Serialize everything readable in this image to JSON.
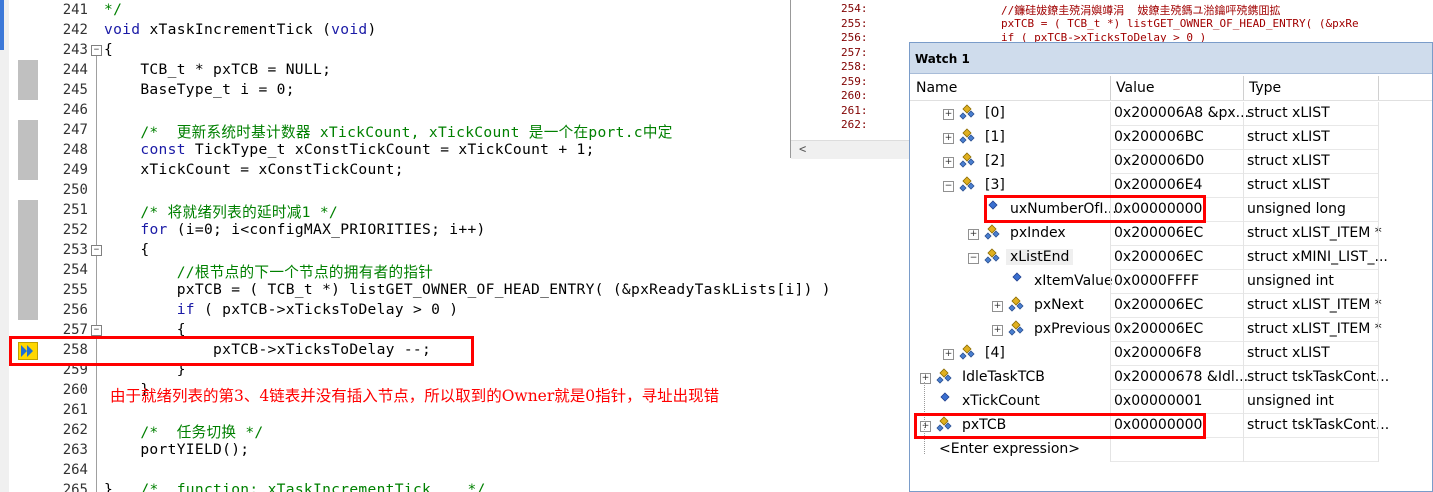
{
  "editor": {
    "lines": [
      {
        "num": "241",
        "text": "*/",
        "fold": "",
        "kind": "comment"
      },
      {
        "num": "242",
        "text": "void xTaskIncrementTick (void)",
        "fold": "",
        "kind": "sig"
      },
      {
        "num": "243",
        "text": "{",
        "fold": "−",
        "kind": "plain"
      },
      {
        "num": "244",
        "text": "    TCB_t * pxTCB = NULL;",
        "fold": "",
        "kind": "plain"
      },
      {
        "num": "245",
        "text": "    BaseType_t i = 0;",
        "fold": "",
        "kind": "plain"
      },
      {
        "num": "246",
        "text": "",
        "fold": "",
        "kind": "plain"
      },
      {
        "num": "247",
        "text": "    /*  更新系统时基计数器 xTickCount, xTickCount 是一个在port.c中定",
        "fold": "",
        "kind": "comment"
      },
      {
        "num": "248",
        "text": "    const TickType_t xConstTickCount = xTickCount + 1;",
        "fold": "",
        "kind": "const"
      },
      {
        "num": "249",
        "text": "    xTickCount = xConstTickCount;",
        "fold": "",
        "kind": "plain"
      },
      {
        "num": "250",
        "text": "",
        "fold": "",
        "kind": "plain"
      },
      {
        "num": "251",
        "text": "    /* 将就绪列表的延时减1 */",
        "fold": "",
        "kind": "comment"
      },
      {
        "num": "252",
        "text": "    for (i=0; i<configMAX_PRIORITIES; i++)",
        "fold": "",
        "kind": "for"
      },
      {
        "num": "253",
        "text": "    {",
        "fold": "−",
        "kind": "plain"
      },
      {
        "num": "254",
        "text": "        //根节点的下一个节点的拥有者的指针",
        "fold": "",
        "kind": "comment"
      },
      {
        "num": "255",
        "text": "        pxTCB = ( TCB_t *) listGET_OWNER_OF_HEAD_ENTRY( (&pxReadyTaskLists[i]) )",
        "fold": "",
        "kind": "plain"
      },
      {
        "num": "256",
        "text": "        if ( pxTCB->xTicksToDelay > 0 )",
        "fold": "",
        "kind": "if"
      },
      {
        "num": "257",
        "text": "        {",
        "fold": "−",
        "kind": "plain"
      },
      {
        "num": "258",
        "text": "            pxTCB->xTicksToDelay --;",
        "fold": "",
        "kind": "plain"
      },
      {
        "num": "259",
        "text": "        }",
        "fold": "",
        "kind": "plain"
      },
      {
        "num": "260",
        "text": "    }",
        "fold": "",
        "kind": "plain"
      },
      {
        "num": "261",
        "text": "",
        "fold": "",
        "kind": "plain"
      },
      {
        "num": "262",
        "text": "    /*  任务切换 */",
        "fold": "",
        "kind": "comment"
      },
      {
        "num": "263",
        "text": "    portYIELD();",
        "fold": "",
        "kind": "plain"
      },
      {
        "num": "264",
        "text": "",
        "fold": "",
        "kind": "plain"
      },
      {
        "num": "265",
        "text": "}   /*  function: xTaskIncrementTick    */",
        "fold": "",
        "kind": "endcomment"
      }
    ],
    "annotation": "由于就绪列表的第3、4链表并没有插入节点，所以取到的Owner就是0指针，寻址出现错"
  },
  "disasm": {
    "lines": [
      {
        "addr": "254:",
        "src": "//鐮硅妭鐐圭殑涓嬩竴涓  妭鐐圭殑鎷ユ湁鑰呯殑鎸囬拡"
      },
      {
        "addr": "255:",
        "src": "pxTCB = ( TCB_t *) listGET_OWNER_OF_HEAD_ENTRY( (&pxRe"
      },
      {
        "addr": "256:",
        "src": "if ( pxTCB->xTicksToDelay > 0 )"
      },
      {
        "addr": "257:",
        "src": ""
      },
      {
        "addr": "258:",
        "src": ""
      },
      {
        "addr": "259:",
        "src": ""
      },
      {
        "addr": "260:",
        "src": ""
      },
      {
        "addr": "261:",
        "src": ""
      },
      {
        "addr": "262:",
        "src": ""
      }
    ]
  },
  "watch": {
    "title": "Watch 1",
    "columns": {
      "name": "Name",
      "value": "Value",
      "type": "Type"
    },
    "rows": [
      {
        "name": "[0]",
        "value": "0x200006A8 &px...",
        "type": "struct xLIST",
        "depth": 1,
        "expander": "+",
        "icon": "struct"
      },
      {
        "name": "[1]",
        "value": "0x200006BC",
        "type": "struct xLIST",
        "depth": 1,
        "expander": "+",
        "icon": "struct"
      },
      {
        "name": "[2]",
        "value": "0x200006D0",
        "type": "struct xLIST",
        "depth": 1,
        "expander": "+",
        "icon": "struct"
      },
      {
        "name": "[3]",
        "value": "0x200006E4",
        "type": "struct xLIST",
        "depth": 1,
        "expander": "−",
        "icon": "struct"
      },
      {
        "name": "uxNumberOfI...",
        "value": "0x00000000",
        "type": "unsigned long",
        "depth": 2,
        "expander": "",
        "icon": "var"
      },
      {
        "name": "pxIndex",
        "value": "0x200006EC",
        "type": "struct xLIST_ITEM *",
        "depth": 2,
        "expander": "+",
        "icon": "struct"
      },
      {
        "name": "xListEnd",
        "value": "0x200006EC",
        "type": "struct xMINI_LIST_...",
        "depth": 2,
        "expander": "−",
        "icon": "struct"
      },
      {
        "name": "xItemValue",
        "value": "0x0000FFFF",
        "type": "unsigned int",
        "depth": 3,
        "expander": "",
        "icon": "var"
      },
      {
        "name": "pxNext",
        "value": "0x200006EC",
        "type": "struct xLIST_ITEM *",
        "depth": 3,
        "expander": "+",
        "icon": "struct"
      },
      {
        "name": "pxPrevious",
        "value": "0x200006EC",
        "type": "struct xLIST_ITEM *",
        "depth": 3,
        "expander": "+",
        "icon": "struct"
      },
      {
        "name": "[4]",
        "value": "0x200006F8",
        "type": "struct xLIST",
        "depth": 1,
        "expander": "+",
        "icon": "struct"
      },
      {
        "name": "IdleTaskTCB",
        "value": "0x20000678 &Idl...",
        "type": "struct tskTaskCont...",
        "depth": 0,
        "expander": "+",
        "icon": "struct"
      },
      {
        "name": "xTickCount",
        "value": "0x00000001",
        "type": "unsigned int",
        "depth": 0,
        "expander": "",
        "icon": "var"
      },
      {
        "name": "pxTCB",
        "value": "0x00000000",
        "type": "struct tskTaskCont...",
        "depth": 0,
        "expander": "+",
        "icon": "struct"
      },
      {
        "name": "<Enter expression>",
        "value": "",
        "type": "",
        "depth": 0,
        "expander": "",
        "icon": ""
      }
    ]
  },
  "colors": {
    "highlight": "#ff0000",
    "comment": "#008000",
    "keyword": "#1a1aa6",
    "annotation": "#ff0000"
  }
}
